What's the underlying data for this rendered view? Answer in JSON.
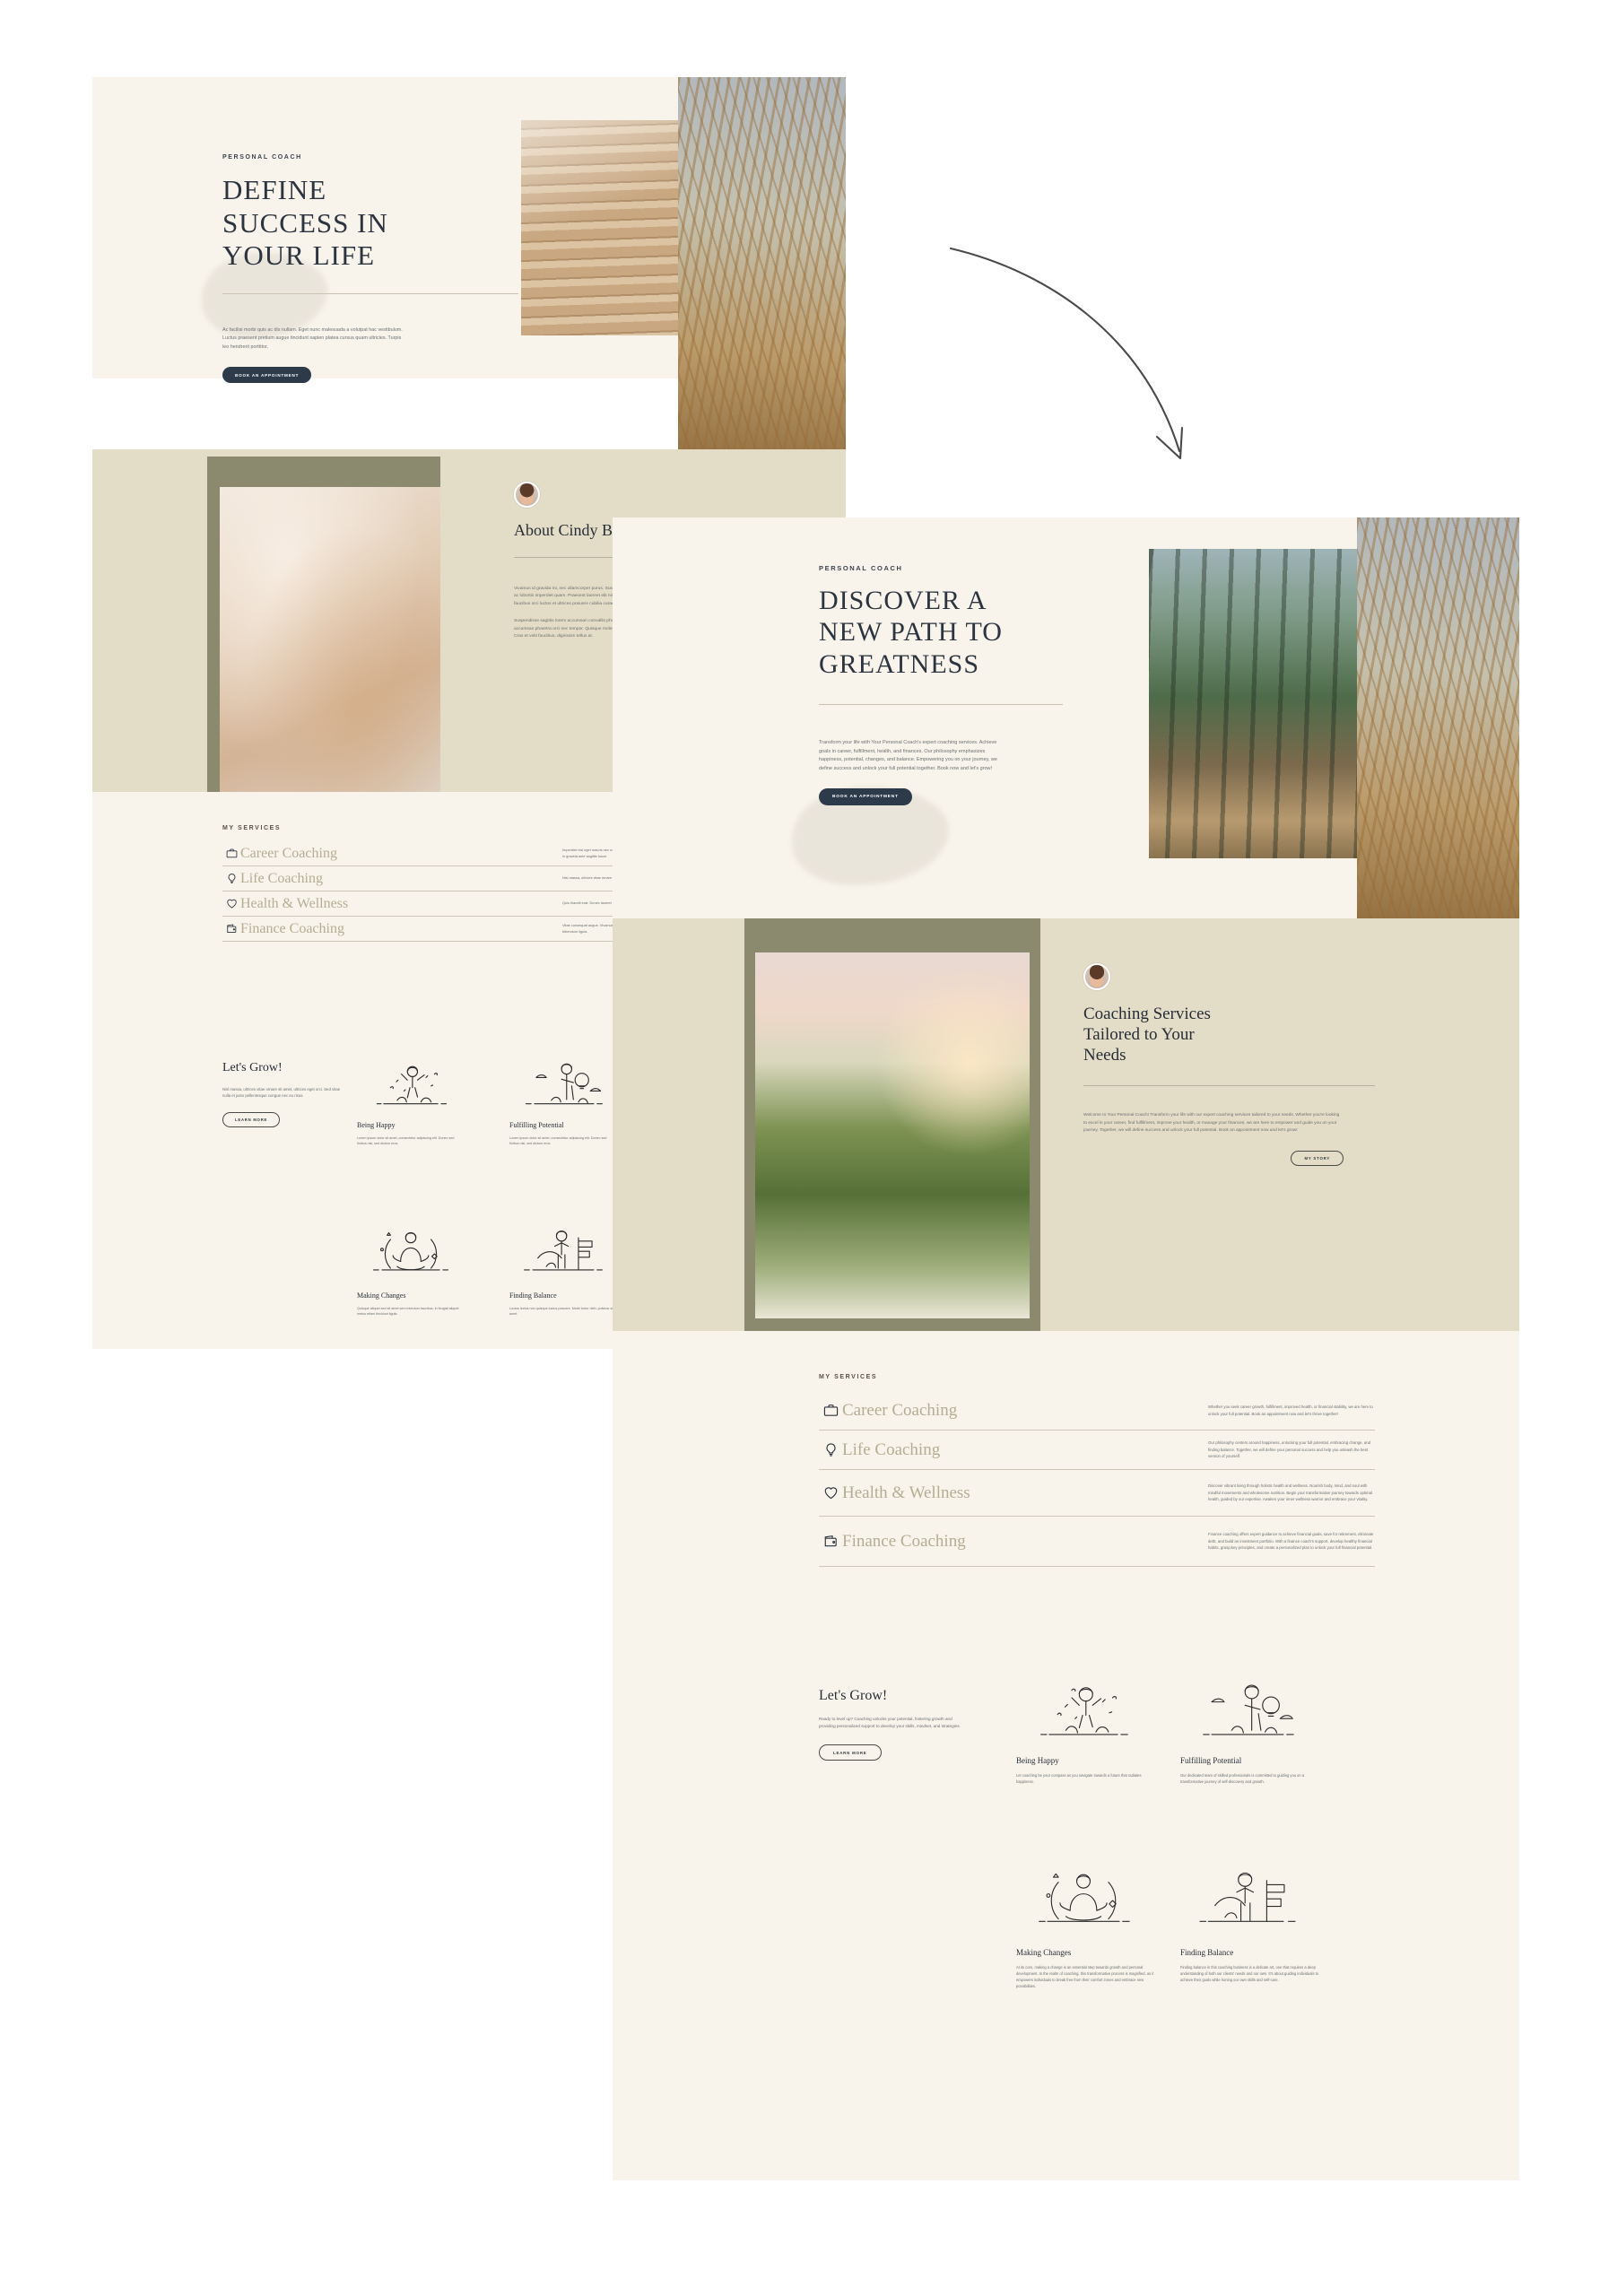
{
  "brand": {
    "eyebrow": "PERSONAL COACH",
    "services_label": "MY SERVICES",
    "accent_dark": "#2c3a4a",
    "accent_sand": "#e3ddc8",
    "accent_cream": "#f8f4ec",
    "accent_olive": "#8b8a6e",
    "service_text_color": "#b6ac93"
  },
  "mock1": {
    "hero": {
      "eyebrow": "PERSONAL COACH",
      "title_lines": [
        "DEFINE",
        "SUCCESS IN",
        "YOUR LIFE"
      ],
      "paragraph": "Ac facilisi morbi quis ac dis nullam. Eget nunc malesuada a volutpat hac vestibulum. Luctus praesent pretium augue tincidunt sapien platea cursus quam ultricies. Turpis leo hendrerit porttitor.",
      "cta": "BOOK AN APPOINTMENT",
      "image_1": "wooden-block-tower-photo",
      "image_2": "pampas-grass-photo"
    },
    "about": {
      "avatar": "coach-portrait-avatar",
      "title": "About Cindy Bradly",
      "paragraph_1": "Vivamus id gravida mi, nec ullamcorper purus. Suspendisse ut nibh sagittis lacus viverra aliquam. Praesent ac lobortis imperdiet quam. Praesent laoreet elit nisi, id feugiat sed. Vestibulum ante ipsum primis in faucibus orci luctus et ultrices posuere cubilia curae.",
      "paragraph_2": "Suspendisse sagittis lorem accumsan convallis pharetra ante, placerat quis purus a. Netus consectetur in accumsan pharetra orci nec tempor. Quisque molestie facilisis. Aliquam ornare nunc nibh, sit amet porta. Cras et velit faucibus, dignissim tellus at.",
      "image": "woman-hands-with-ring-photo"
    },
    "services": {
      "label": "MY SERVICES",
      "items": [
        {
          "icon": "briefcase-icon",
          "name": "Career Coaching",
          "desc": "Imperdiet nisl eget mauris nec non dictum. Malesuada ullamcorper mattis massa in ullamcorper, in gravida ante sagittis fusce."
        },
        {
          "icon": "lightbulb-icon",
          "name": "Life Coaching",
          "desc": "Nisl massa, ultrices vitae ornare sit amet. Sed vitae nulla et justo pellentesque convallis."
        },
        {
          "icon": "heart-icon",
          "name": "Health & Wellness",
          "desc": "Quis blandit erat. Donec laoreet libero in consequat in vel metus. Sed non augue dictum."
        },
        {
          "icon": "wallet-icon",
          "name": "Finance Coaching",
          "desc": "Vitae consequat augue. Vivamus eget dui condimentum sodales in bibendum nisl. Curabitur non bibendum ligula."
        }
      ]
    },
    "grow": {
      "title": "Let's Grow!",
      "paragraph": "Nisl massa, ultrices vitae ornare sit amet, ultrices eget orci. Sed vitae nulla et justo pellentesque congue nec eu risus.",
      "cta": "LEARN MORE",
      "cards": [
        {
          "illustration": "person-celebrating-illustration",
          "title": "Being Happy",
          "desc": "Lorem ipsum dolor sit amet, consectetur adipiscing elit. Donec sed finibus nisi, sed dictum eros."
        },
        {
          "illustration": "person-holding-lightbulb-illustration",
          "title": "Fulfilling Potential",
          "desc": "Lorem ipsum dolor sit amet, consectetur adipiscing elit. Donec sed finibus nisi, sed dictum eros."
        },
        {
          "illustration": "person-meditating-illustration",
          "title": "Making Changes",
          "desc": "Quisque aliquet sed sit amet sem interdum faucibus, in feugiat aliquet metus etiam tincidunt ligula."
        },
        {
          "illustration": "person-at-signpost-illustration",
          "title": "Finding Balance",
          "desc": "Luctus lectus non quisque luctus posuere. Morbi tortor nibh, pulvinar sit amet."
        }
      ]
    }
  },
  "mock2": {
    "hero": {
      "eyebrow": "PERSONAL COACH",
      "title_lines": [
        "DISCOVER A",
        "NEW PATH TO",
        "GREATNESS"
      ],
      "paragraph": "Transform your life with Your Personal Coach's expert coaching services. Achieve goals in career, fulfillment, health, and finances. Our philosophy emphasizes happiness, potential, changes, and balance. Empowering you on your journey, we define success and unlock your full potential together. Book now and let's grow!",
      "cta": "BOOK AN APPOINTMENT",
      "image_1": "forest-path-photo",
      "image_2": "pampas-grass-photo"
    },
    "band": {
      "avatar": "coach-portrait-avatar",
      "title_lines": [
        "Coaching Services",
        "Tailored to Your",
        "Needs"
      ],
      "paragraph": "Welcome to Your Personal Coach! Transform your life with our expert coaching services tailored to your needs. Whether you're looking to excel in your career, find fulfillment, improve your health, or manage your finances, we are here to empower and guide you on your journey. Together, we will define success and unlock your full potential. Book an appointment now and let's grow!",
      "cta": "MY STORY",
      "image": "woman-walking-in-flower-field-photo"
    },
    "services": {
      "label": "MY SERVICES",
      "items": [
        {
          "icon": "briefcase-icon",
          "name": "Career Coaching",
          "desc": "Whether you seek career growth, fulfillment, improved health, or financial stability, we are here to unlock your full potential. Book an appointment now and let's thrive together!"
        },
        {
          "icon": "lightbulb-icon",
          "name": "Life Coaching",
          "desc": "Our philosophy centers around happiness, unlocking your full potential, embracing change, and finding balance. Together, we will define your personal success and help you unleash the best version of yourself."
        },
        {
          "icon": "heart-icon",
          "name": "Health & Wellness",
          "desc": "Discover vibrant living through holistic health and wellness. Nourish body, mind, and soul with mindful movements and wholesome nutrition. Begin your transformative journey towards optimal health, guided by our expertise. Awaken your inner wellness warrior and embrace your vitality."
        },
        {
          "icon": "wallet-icon",
          "name": "Finance Coaching",
          "desc": "Finance coaching offers expert guidance to achieve financial goals, save for retirement, eliminate debt, and build an investment portfolio. With a finance coach's support, develop healthy financial habits, grasp key principles, and create a personalized plan to unlock your full financial potential."
        }
      ]
    },
    "grow": {
      "title": "Let's Grow!",
      "paragraph": "Ready to level up? Coaching unlocks your potential, fostering growth and providing personalized support to develop your skills, mindset, and strategies.",
      "cta": "LEARN MORE",
      "cards": [
        {
          "illustration": "person-celebrating-illustration",
          "title": "Being Happy",
          "desc": "Let coaching be your compass as you navigate towards a future that radiates happiness."
        },
        {
          "illustration": "person-holding-lightbulb-illustration",
          "title": "Fulfilling Potential",
          "desc": "Our dedicated team of skilled professionals is committed to guiding you on a transformative journey of self-discovery and growth."
        },
        {
          "illustration": "person-meditating-illustration",
          "title": "Making Changes",
          "desc": "At its core, making a change is an essential step towards growth and personal development. In the realm of coaching, this transformative process is magnified, as it empowers individuals to break free from their comfort zones and embrace new possibilities."
        },
        {
          "illustration": "person-at-signpost-illustration",
          "title": "Finding Balance",
          "desc": "Finding balance in this coaching business is a delicate art, one that requires a deep understanding of both our clients' needs and our own. It's about guiding individuals to achieve their goals while honing our own skills and self-care."
        }
      ]
    }
  },
  "annotation": {
    "arrow": "curved-arrow-pointing-down-right"
  }
}
